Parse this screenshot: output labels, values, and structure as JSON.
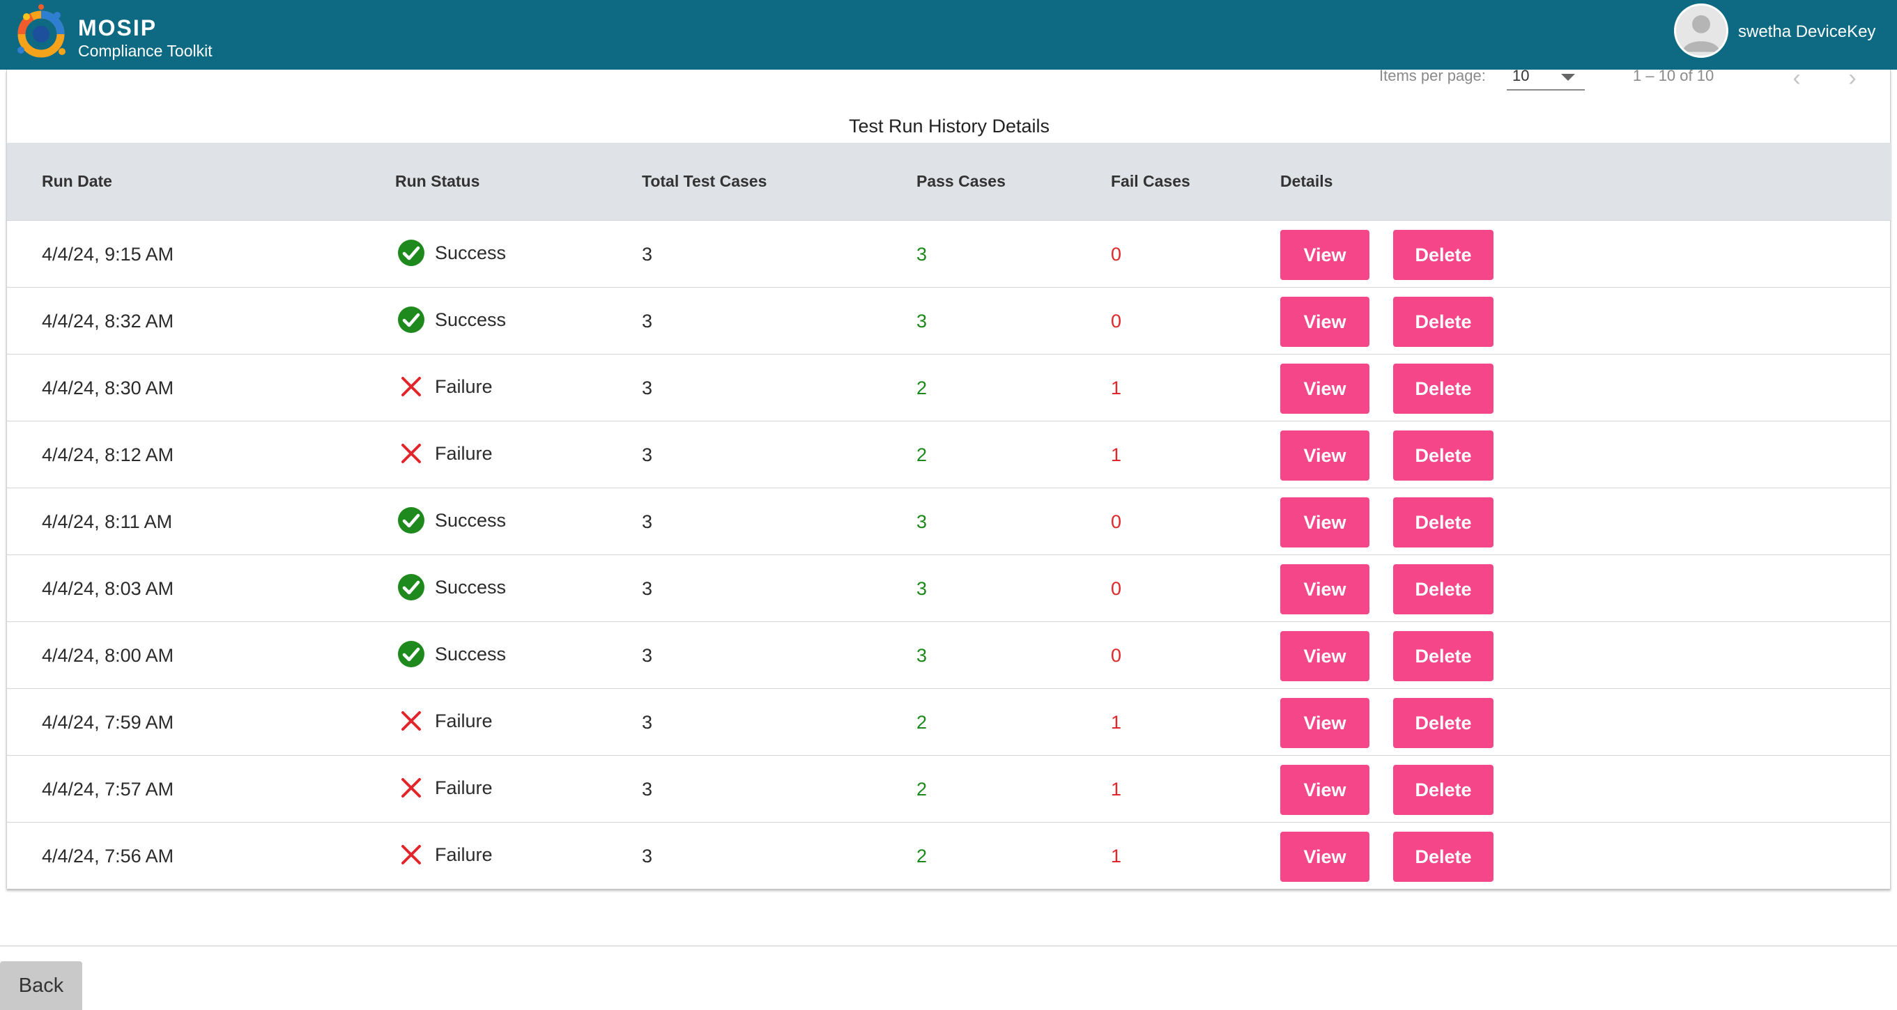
{
  "header": {
    "brand_name": "MOSIP",
    "brand_sub": "Compliance Toolkit",
    "user_name": "swetha DeviceKey"
  },
  "paginator": {
    "items_per_page_label": "Items per page:",
    "items_per_page_value": "10",
    "range_label": "1 – 10 of 10",
    "prev_glyph": "‹",
    "next_glyph": "›"
  },
  "table": {
    "title": "Test Run History Details",
    "columns": [
      "Run Date",
      "Run Status",
      "Total Test Cases",
      "Pass Cases",
      "Fail Cases",
      "Details"
    ],
    "view_label": "View",
    "delete_label": "Delete",
    "rows": [
      {
        "date": "4/4/24, 9:15 AM",
        "status": "Success",
        "total": "3",
        "pass": "3",
        "fail": "0"
      },
      {
        "date": "4/4/24, 8:32 AM",
        "status": "Success",
        "total": "3",
        "pass": "3",
        "fail": "0"
      },
      {
        "date": "4/4/24, 8:30 AM",
        "status": "Failure",
        "total": "3",
        "pass": "2",
        "fail": "1"
      },
      {
        "date": "4/4/24, 8:12 AM",
        "status": "Failure",
        "total": "3",
        "pass": "2",
        "fail": "1"
      },
      {
        "date": "4/4/24, 8:11 AM",
        "status": "Success",
        "total": "3",
        "pass": "3",
        "fail": "0"
      },
      {
        "date": "4/4/24, 8:03 AM",
        "status": "Success",
        "total": "3",
        "pass": "3",
        "fail": "0"
      },
      {
        "date": "4/4/24, 8:00 AM",
        "status": "Success",
        "total": "3",
        "pass": "3",
        "fail": "0"
      },
      {
        "date": "4/4/24, 7:59 AM",
        "status": "Failure",
        "total": "3",
        "pass": "2",
        "fail": "1"
      },
      {
        "date": "4/4/24, 7:57 AM",
        "status": "Failure",
        "total": "3",
        "pass": "2",
        "fail": "1"
      },
      {
        "date": "4/4/24, 7:56 AM",
        "status": "Failure",
        "total": "3",
        "pass": "2",
        "fail": "1"
      }
    ]
  },
  "footer": {
    "back_label": "Back"
  },
  "colors": {
    "header_bg": "#0d6a82",
    "button_pink": "#f5468a",
    "pass_green": "#1b8a1b",
    "fail_red": "#e0262b",
    "success_icon": "#1e8a1e",
    "failure_icon": "#e0262b"
  }
}
